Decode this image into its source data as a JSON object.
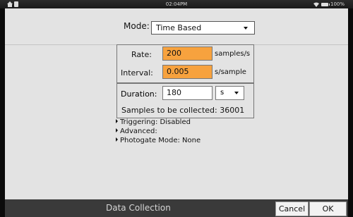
{
  "statusbar": {
    "time": "02:04PM",
    "battery_text": "100%"
  },
  "mode": {
    "label": "Mode:",
    "value": "Time Based"
  },
  "rate": {
    "label": "Rate:",
    "value": "200",
    "unit": "samples/s"
  },
  "interval": {
    "label": "Interval:",
    "value": "0.005",
    "unit": "s/sample"
  },
  "duration": {
    "label": "Duration:",
    "value": "180",
    "unit_value": "s"
  },
  "samples": {
    "text": "Samples to be collected: 36001"
  },
  "options": [
    {
      "label": "Triggering: Disabled"
    },
    {
      "label": "Advanced:"
    },
    {
      "label": "Photogate Mode: None"
    }
  ],
  "bottombar": {
    "title": "Data Collection",
    "cancel_label": "Cancel",
    "ok_label": "OK"
  },
  "colors": {
    "highlight": "#f7a23e",
    "screen_bg": "#e3e3e3",
    "bar_bg": "#3a3a3a"
  }
}
